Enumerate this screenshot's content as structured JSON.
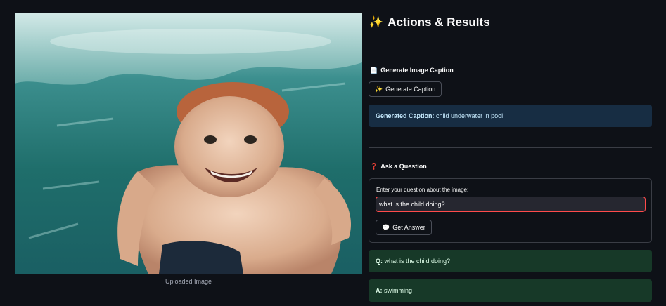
{
  "left": {
    "image_caption": "Uploaded Image"
  },
  "right": {
    "title_emoji": "✨",
    "title": "Actions & Results",
    "caption_section": {
      "heading_emoji": "📄",
      "heading": "Generate Image Caption",
      "button_emoji": "✨",
      "button_label": "Generate Caption",
      "result_label": "Generated Caption:",
      "result_value": "child underwater in pool"
    },
    "question_section": {
      "heading_emoji": "❓",
      "heading": "Ask a Question",
      "input_label": "Enter your question about the image:",
      "input_value": "what is the child doing?",
      "button_emoji": "💬",
      "button_label": "Get Answer",
      "q_label": "Q:",
      "q_value": "what is the child doing?",
      "a_label": "A:",
      "a_value": "swimming"
    }
  },
  "colors": {
    "background": "#0e1117",
    "info_blue": "#172d43",
    "success_green": "#173928",
    "input_focus_border": "#ff4b4b"
  }
}
